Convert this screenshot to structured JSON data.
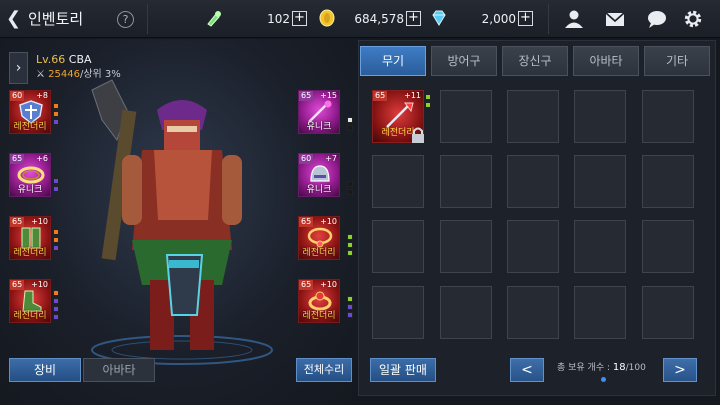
{
  "header": {
    "title": "인벤토리",
    "help_label": "?",
    "currencies": [
      {
        "icon": "stamina-potion-icon",
        "value": "102",
        "plus": "+"
      },
      {
        "icon": "gold-coin-icon",
        "value": "684,578",
        "plus": "+"
      },
      {
        "icon": "diamond-gem-icon",
        "value": "2,000",
        "plus": "+"
      }
    ],
    "icons": [
      "user-icon",
      "mail-icon",
      "chat-icon",
      "settings-icon"
    ]
  },
  "character": {
    "level": "Lv.66",
    "name": "CBA",
    "power": "25446",
    "rank": "/상위 3%"
  },
  "equipment_left": [
    {
      "lvl": "60",
      "enh": "+8",
      "grade": "레전더리",
      "icon": "shield-armor-icon",
      "rarity": "legendary"
    },
    {
      "lvl": "65",
      "enh": "+6",
      "grade": "유니크",
      "icon": "bracelet-icon",
      "rarity": "unique"
    },
    {
      "lvl": "65",
      "enh": "+10",
      "grade": "레전더리",
      "icon": "leg-armor-icon",
      "rarity": "legendary"
    },
    {
      "lvl": "65",
      "enh": "+10",
      "grade": "레전더리",
      "icon": "boots-icon",
      "rarity": "legendary"
    }
  ],
  "equipment_right": [
    {
      "lvl": "65",
      "enh": "+15",
      "grade": "유니크",
      "icon": "staff-weapon-icon",
      "rarity": "unique"
    },
    {
      "lvl": "60",
      "enh": "+7",
      "grade": "유니크",
      "icon": "helmet-icon",
      "rarity": "unique"
    },
    {
      "lvl": "65",
      "enh": "+10",
      "grade": "레전더리",
      "icon": "necklace-icon",
      "rarity": "legendary"
    },
    {
      "lvl": "65",
      "enh": "+10",
      "grade": "레전더리",
      "icon": "ring-icon",
      "rarity": "legendary"
    }
  ],
  "bottom_left": {
    "equip_tab": "장비",
    "avatar_tab": "아바타",
    "repair_all": "전체수리"
  },
  "inventory": {
    "tabs": [
      "무기",
      "방어구",
      "장신구",
      "아바타",
      "기타"
    ],
    "active_tab": 0,
    "item": {
      "lvl": "65",
      "enh": "+11",
      "grade": "레전더리",
      "icon": "spear-weapon-icon",
      "locked": true
    },
    "bulk_sell": "일괄 판매",
    "count_label": "총 보유 개수 :",
    "count_current": "18",
    "count_max": "/100",
    "prev": "<",
    "next": ">"
  },
  "colors": {
    "accent": "#3f7cc4",
    "legendary": "#b81e1e",
    "unique": "#b42ab0",
    "gold": "#e9c14a"
  }
}
